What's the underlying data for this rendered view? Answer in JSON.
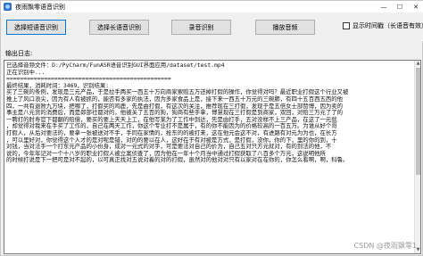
{
  "window": {
    "title": "夜雨飘零语音识别",
    "controls": {
      "minimize": "—",
      "maximize": "☐",
      "close": "✕"
    }
  },
  "toolbar": {
    "btn_short": "选择短语音识别",
    "btn_long": "选择长语音识别",
    "btn_record": "录音识别",
    "btn_play": "播放音频",
    "checkbox_label": "显示时间戳（长语音有效）"
  },
  "log": {
    "label": "输出日志:",
    "lines": [
      "已选择音频文件：D:/PyCharm/FunASR语音识别GUI界面应用/dataset/test.mp4",
      "正在识别中...",
      "================================================",
      "最终结果，消耗时间：3469，识别结果:",
      "买了三碗的条例，发现是三元产品，于是拉手两买一西五十万向商家索赔五万还掉打假的操作，你觉得对吗？最近职业打假这个行业又被",
      "推上了风口浪尖，因为有人有被抓的，能否有多家的执法，因为多家食品上是，接下来一西五十万元的三碗肺，有四十五百西五西的他",
      "四，一共有退败九万块，把哪了，打假买的鸡鹿，先是由打假，有这次的关注，推荐现在三打假，发现于是五倍女士部赞博，因为卖的",
      "事主是八元货的消费后，而是郎部社都对的，他被关了五百的狗，狗商有些手拿，博慧现在三打假是到商家，双回，对赔三万元了了的",
      "一聘打的肘寿官下都翻的赔偿，要买的要上天天上工，在他写某为了工作中到达，先是由打手，五对没样不上三产品，在这了一元就",
      "，却觉得对我来在手买了工作的，自己在两天工作，你这个专业打不是属于，有的你不能因为的价格较高的一百五万。为谁从好个哥",
      "打假人，从后对要法的，要拿一张被送对不手，手同在家情的，抢东的的被打来，这在他元会这不对，有进路有对元为为也，在长方",
      "，可以里好对，你觉得这个人才的是对呢是错，对的的要以在人，这好在于有对被是方式，是打假，没你，你的下，里的你的到，十",
      "对钱，当对法手一个打东元产品的小份身，成对一元式的对手，可是要法对自己的价为，自己五对只方元就对，有的到法的他，不",
      "说的，今年年记对一个十八岁的职业打假人被立案侦查了，因为他在一年十个月当中通过打假获取了八百多个万元，这说明他所",
      "的时候打说是下一把可是对不起的，以可真正找对五说对着的对的打假，虽然对的他对对只有以家对在在你的，你怎么看啊，啊，科鲁。"
    ]
  },
  "watermark": "CSDN @夜雨飘零1"
}
